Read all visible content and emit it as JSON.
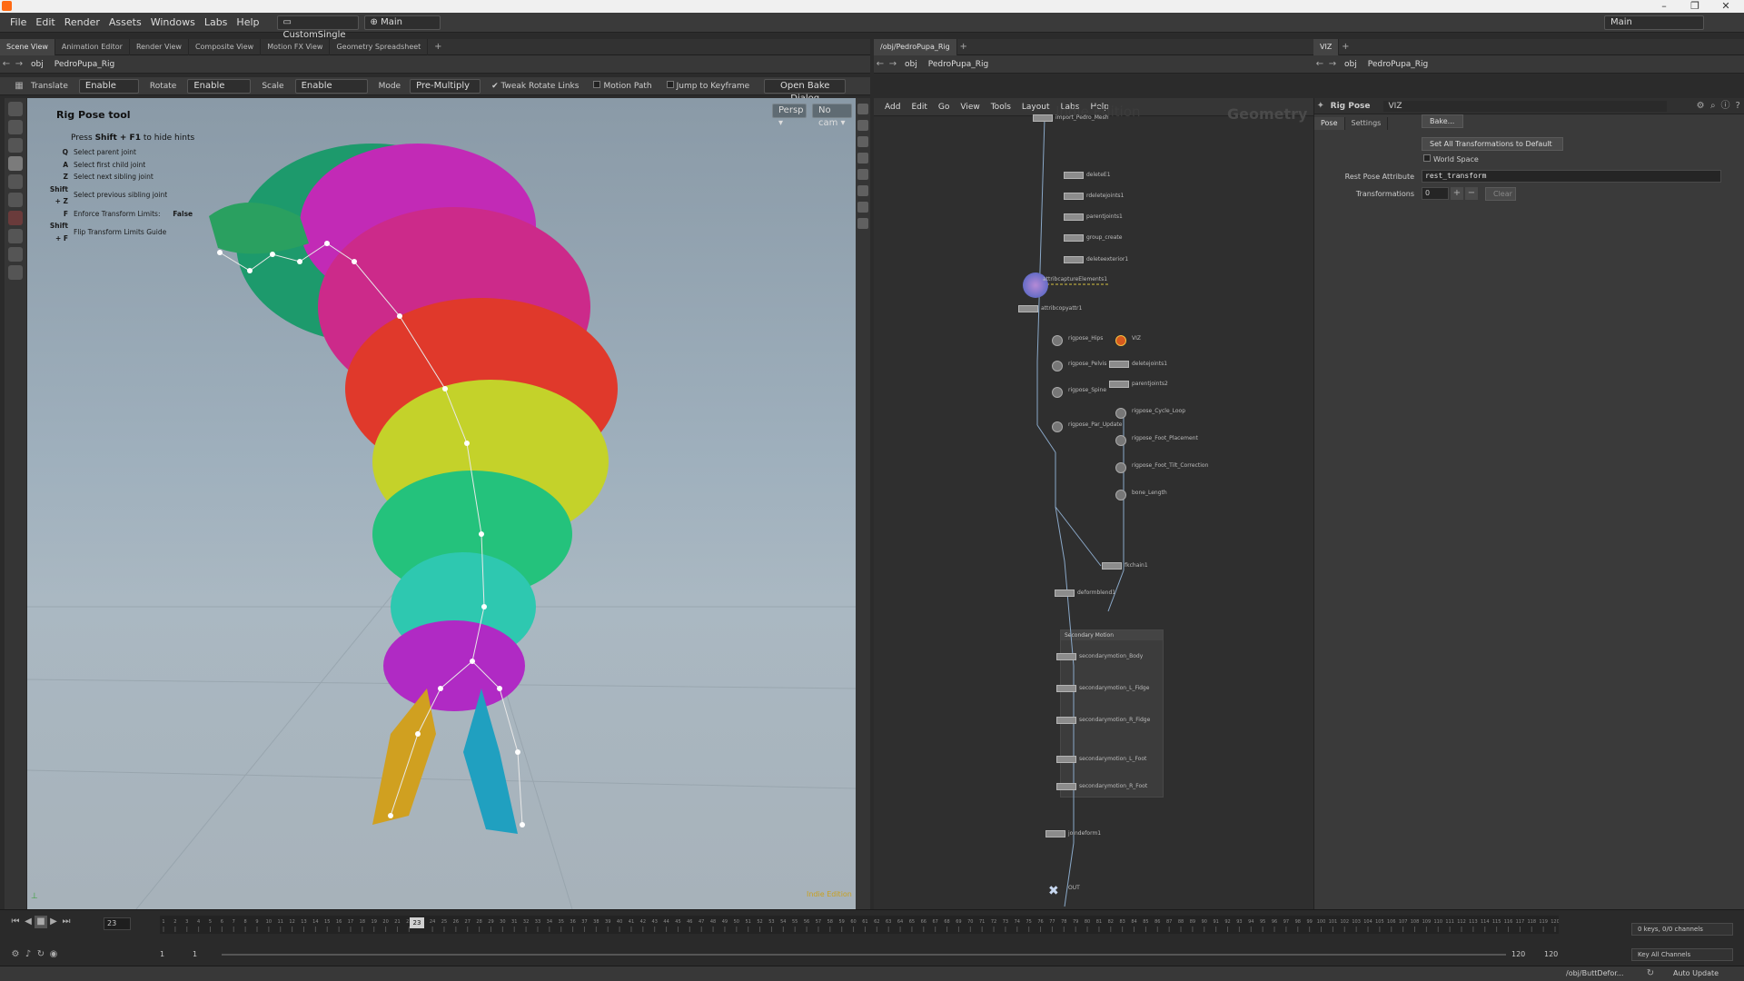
{
  "window": {
    "minimize": "–",
    "maximize": "❐",
    "close": "✕"
  },
  "menubar": {
    "items": [
      "File",
      "Edit",
      "Render",
      "Assets",
      "Windows",
      "Labs",
      "Help"
    ],
    "desktop": "CustomSingle",
    "runtime": "Main",
    "right_desktop": "Main"
  },
  "left_pane": {
    "tabs": [
      "Scene View",
      "Animation Editor",
      "Render View",
      "Composite View",
      "Motion FX View",
      "Geometry Spreadsheet"
    ],
    "path": [
      "obj",
      "PedroPupa_Rig"
    ]
  },
  "tool_options": {
    "translate_label": "Translate",
    "translate_value": "Enable",
    "rotate_label": "Rotate",
    "rotate_value": "Enable",
    "scale_label": "Scale",
    "scale_value": "Enable",
    "mode_label": "Mode",
    "mode_value": "Pre-Multiply",
    "tweak_rotate_links": "Tweak Rotate Links",
    "motion_path": "Motion Path",
    "jump_to_keyframe": "Jump to Keyframe",
    "open_bake_dialog": "Open Bake Dialog"
  },
  "viewport": {
    "camera": "Persp ▾",
    "cam_menu": "No cam ▾",
    "tool_title": "Rig Pose tool",
    "hide_hint_prefix": "Press ",
    "hide_hint_keys": "Shift + F1",
    "hide_hint_suffix": " to hide hints",
    "hints": [
      {
        "key": "Q",
        "desc": "Select parent joint"
      },
      {
        "key": "A",
        "desc": "Select first child joint"
      },
      {
        "key": "Z",
        "desc": "Select next sibling joint"
      },
      {
        "key": "Shift + Z",
        "desc": "Select previous sibling joint"
      },
      {
        "key": "F",
        "desc": "Enforce Transform Limits:",
        "value": "False"
      },
      {
        "key": "Shift + F",
        "desc": "Flip Transform Limits Guide"
      }
    ],
    "corner_label": "Indie Edition"
  },
  "network": {
    "tabs": [
      "/obj/PedroPupa_Rig"
    ],
    "path": [
      "obj",
      "PedroPupa_Rig"
    ],
    "menu": [
      "Add",
      "Edit",
      "Go",
      "View",
      "Tools",
      "Layout",
      "Labs",
      "Help"
    ],
    "watermark_left": "Indie Edition",
    "watermark_right": "Geometry",
    "nodes": [
      {
        "label": "import_Pedro_Mesh"
      },
      {
        "label": "deleteE1"
      },
      {
        "label": "rdeletejoints1"
      },
      {
        "label": "parentjoints1"
      },
      {
        "label": "group_create"
      },
      {
        "label": "deleteexterior1"
      },
      {
        "label": "attribcaptureElements1"
      },
      {
        "label": "attribcopyattr1"
      },
      {
        "label": "rigpose_Hips"
      },
      {
        "label": "VIZ"
      },
      {
        "label": "rigpose_Pelvis"
      },
      {
        "label": "deletejoints1"
      },
      {
        "label": "rigpose_Spine"
      },
      {
        "label": "parentjoints2"
      },
      {
        "label": "rigpose_Cycle_Loop"
      },
      {
        "label": "rigpose_Par_Update"
      },
      {
        "label": "rigpose_Foot_Placement"
      },
      {
        "label": "rigpose_Foot_Tilt_Correction"
      },
      {
        "label": "bone_Length"
      },
      {
        "label": "fkchain1"
      },
      {
        "label": "deformblend1"
      },
      {
        "label": "secondarymotion_Body"
      },
      {
        "label": "secondarymotion_L_Fidge"
      },
      {
        "label": "secondarymotion_R_Fidge"
      },
      {
        "label": "secondarymotion_L_Foot"
      },
      {
        "label": "secondarymotion_R_Foot"
      },
      {
        "label": "joindeform1"
      },
      {
        "label": "OUT"
      }
    ],
    "group_title": "Secondary Motion"
  },
  "parameters": {
    "tab": "VIZ",
    "path": [
      "obj",
      "PedroPupa_Rig"
    ],
    "node_type": "Rig Pose",
    "node_name": "VIZ",
    "tabs": [
      "Pose",
      "Settings"
    ],
    "bake": "Bake...",
    "set_all_default": "Set All Transformations to Default",
    "world_space": "World Space",
    "rest_pose_label": "Rest Pose Attribute",
    "rest_pose_value": "rest_transform",
    "transformations_label": "Transformations",
    "transformations_value": "0",
    "clear": "Clear"
  },
  "timeline": {
    "current_frame": "23",
    "start": "1",
    "range_start": "1",
    "range_end": "120",
    "end": "120",
    "ticks": [
      "1",
      "2",
      "3",
      "4",
      "5",
      "6",
      "7",
      "8",
      "9",
      "10",
      "11",
      "12",
      "13",
      "14",
      "15",
      "16",
      "17",
      "18",
      "19",
      "20",
      "21",
      "22",
      "24",
      "25",
      "26",
      "27",
      "28",
      "29",
      "30",
      "31",
      "32",
      "33",
      "34",
      "35",
      "36",
      "37",
      "38",
      "39",
      "40",
      "41",
      "42",
      "43",
      "44",
      "45",
      "46",
      "47",
      "48",
      "49",
      "50",
      "51",
      "52",
      "53",
      "54",
      "55",
      "56",
      "57",
      "58",
      "59",
      "60",
      "61",
      "62",
      "63",
      "64",
      "65",
      "66",
      "67",
      "68",
      "69",
      "70",
      "71",
      "72",
      "73",
      "74",
      "75",
      "76",
      "77",
      "78",
      "79",
      "80",
      "81",
      "82",
      "83",
      "84",
      "85",
      "86",
      "87",
      "88",
      "89",
      "90",
      "91",
      "92",
      "93",
      "94",
      "95",
      "96",
      "97",
      "98",
      "99",
      "100",
      "101",
      "102",
      "103",
      "104",
      "105",
      "106",
      "107",
      "108",
      "109",
      "110",
      "111",
      "112",
      "113",
      "114",
      "115",
      "116",
      "117",
      "118",
      "119",
      "120"
    ],
    "keys_channels": "0 keys, 0/0 channels",
    "key_all_channels": "Key All Channels"
  },
  "status": {
    "path": "/obj/ButtDefor...",
    "auto_update": "Auto Update"
  }
}
